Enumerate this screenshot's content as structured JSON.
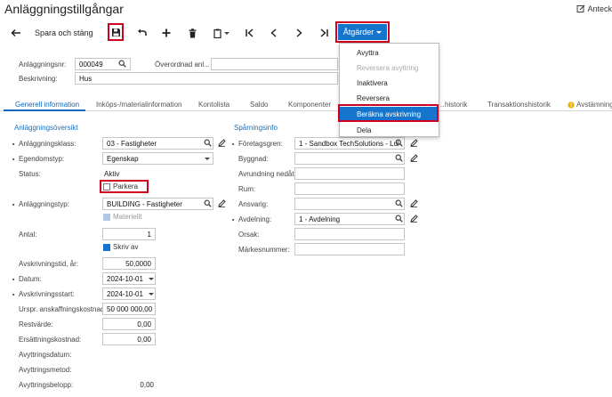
{
  "header": {
    "title": "Anläggningstillgångar",
    "notes_label": "Anteck"
  },
  "toolbar": {
    "save_close_label": "Spara och stäng",
    "actions_label": "Åtgärder"
  },
  "top_form": {
    "asset_no_label": "Anläggningsnr:",
    "asset_no_value": "000049",
    "parent_label": "Överordnad anl...",
    "description_label": "Beskrivning:",
    "description_value": "Hus"
  },
  "tabs": [
    {
      "label": "Generell information",
      "active": true
    },
    {
      "label": "Inköps-/materialinformation"
    },
    {
      "label": "Kontolista"
    },
    {
      "label": "Saldo"
    },
    {
      "label": "Komponenter"
    },
    {
      "label": "…historik"
    },
    {
      "label": "Transaktionshistorik"
    },
    {
      "label": "Avstämning"
    }
  ],
  "actions_menu": [
    {
      "label": "Avyttra"
    },
    {
      "label": "Reversera avyttring",
      "disabled": true
    },
    {
      "label": "Inaktivera"
    },
    {
      "label": "Reversera"
    },
    {
      "label": "Beräkna avskrivning",
      "highlighted": true
    },
    {
      "label": "Dela"
    }
  ],
  "overview": {
    "section_title": "Anläggningsöversikt",
    "class_label": "Anläggningsklass:",
    "class_value": "03 - Fastigheter",
    "ownership_label": "Egendomstyp:",
    "ownership_value": "Egenskap",
    "status_label": "Status:",
    "status_value": "Aktiv",
    "park_label": "Parkera",
    "park_checked": false,
    "type_label": "Anläggningstyp:",
    "type_value": "BUILDING - Fastigheter",
    "tangible_label": "Materiellt",
    "tangible_checked": true,
    "qty_label": "Antal:",
    "qty_value": "1",
    "depreciate_label": "Skriv av",
    "depreciate_checked": true,
    "useful_life_label": "Avskrivningstid, år:",
    "useful_life_value": "50,0000",
    "date_label": "Datum:",
    "date_value": "2024-10-01",
    "dep_start_label": "Avskrivningsstart:",
    "dep_start_value": "2024-10-01",
    "orig_cost_label": "Urspr. anskaffningskostnad:",
    "orig_cost_value": "50 000 000,00",
    "salvage_label": "Restvärde:",
    "salvage_value": "0,00",
    "replacement_label": "Ersättningskostnad:",
    "replacement_value": "0,00",
    "disposal_date_label": "Avyttringsdatum:",
    "disposal_method_label": "Avyttringsmetod:",
    "disposal_amount_label": "Avyttringsbelopp:",
    "disposal_amount_value": "0,00"
  },
  "tracking": {
    "section_title": "Spårningsinfo",
    "company_label": "Företagsgren:",
    "company_value": "1 - Sandbox TechSolutions - Lul",
    "building_label": "Byggnad:",
    "floor_label": "Avrundning nedåt:",
    "room_label": "Rum:",
    "custodian_label": "Ansvarig:",
    "department_label": "Avdelning:",
    "department_value": "1 - Avdelning",
    "reason_label": "Orsak:",
    "tag_label": "Märkesnummer:"
  },
  "colors": {
    "accent": "#1575cc",
    "highlight_box": "#d00020",
    "link_blue": "#1a6fb8"
  }
}
